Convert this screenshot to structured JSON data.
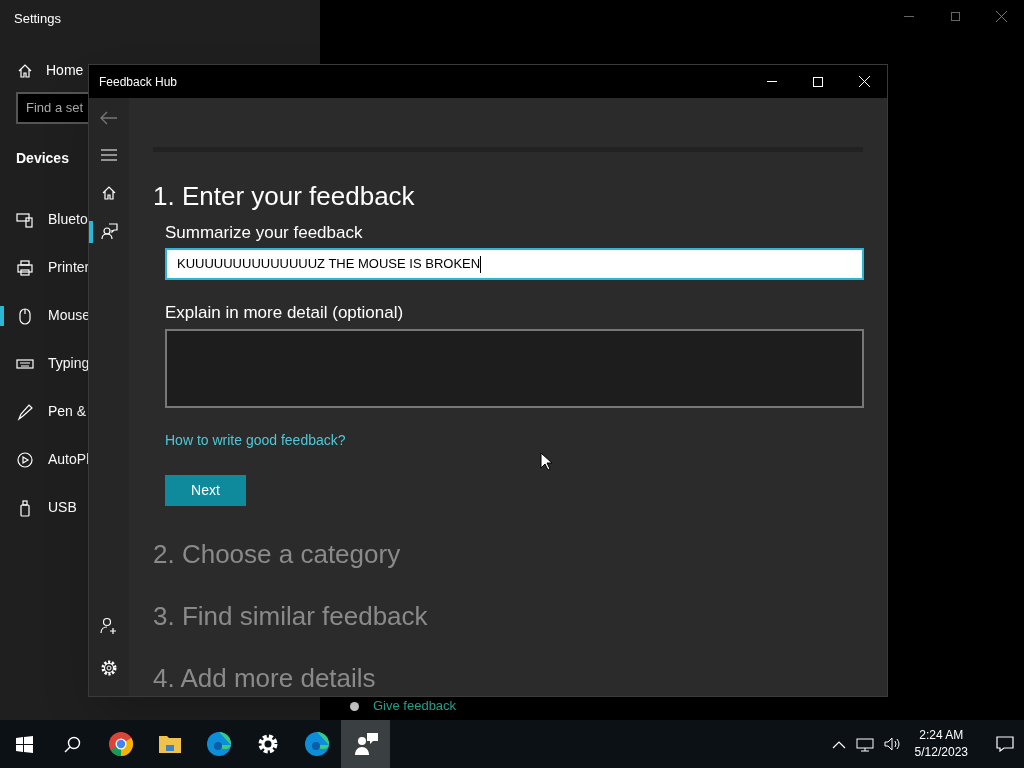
{
  "settings_window": {
    "title": "Settings",
    "home": "Home",
    "search": {
      "placeholder": "Find a set"
    },
    "section": "Devices",
    "items": [
      {
        "label": "Blueto",
        "kind": "bluetooth",
        "selected": false
      },
      {
        "label": "Printer",
        "kind": "printer",
        "selected": false
      },
      {
        "label": "Mouse",
        "kind": "mouse",
        "selected": true
      },
      {
        "label": "Typing",
        "kind": "keyboard",
        "selected": false
      },
      {
        "label": "Pen &",
        "kind": "pen",
        "selected": false
      },
      {
        "label": "AutoPl",
        "kind": "autoplay",
        "selected": false
      },
      {
        "label": "USB",
        "kind": "usb",
        "selected": false
      }
    ],
    "link": "Give feedback"
  },
  "feedback_window": {
    "title": "Feedback Hub",
    "nav": [
      {
        "kind": "home",
        "selected": false
      },
      {
        "kind": "feedback",
        "selected": true
      }
    ],
    "step_1": "1. Enter your feedback",
    "summary_label": "Summarize your feedback",
    "summary_value": "KUUUUUUUUUUUUUUZ THE MOUSE IS BROKEN",
    "detail_label": "Explain in more detail (optional)",
    "help_link": "How to write good feedback?",
    "next": "Next",
    "steps": [
      "2. Choose a category",
      "3. Find similar feedback",
      "4. Add more details"
    ]
  },
  "taskbar": {
    "apps": [
      {
        "kind": "chrome",
        "selected": false
      },
      {
        "kind": "folder",
        "selected": false
      },
      {
        "kind": "edge",
        "selected": false
      },
      {
        "kind": "gear",
        "selected": false
      },
      {
        "kind": "edge",
        "selected": false
      },
      {
        "kind": "feedback",
        "selected": true
      }
    ],
    "time": "2:24 AM",
    "date": "5/12/2023"
  }
}
